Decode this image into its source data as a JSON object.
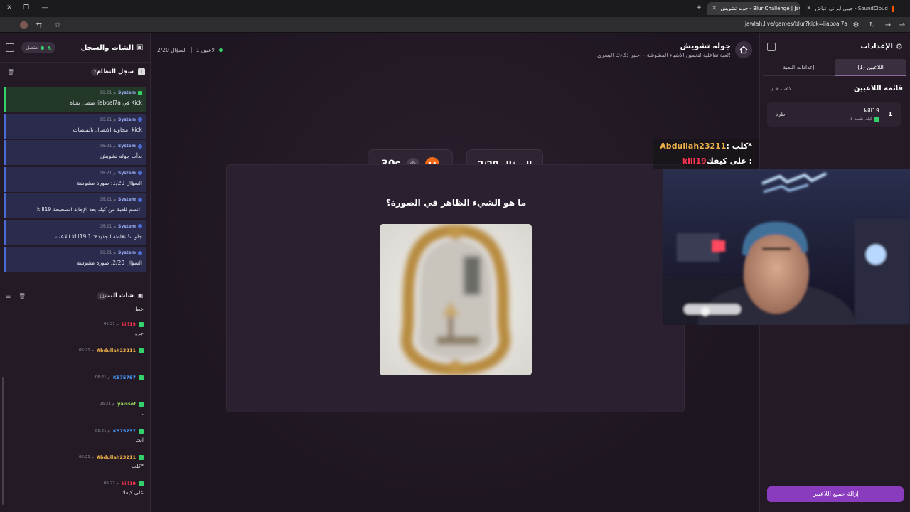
{
  "browser": {
    "tabs": [
      {
        "label": "جيبي ابراني عياش - SoundCloud",
        "favicon_color": "#ff5500"
      },
      {
        "label": "جوله تشويش - Blur Challenge | Jawla",
        "favicon_color": "#cccccc"
      }
    ],
    "url": "jawlah.live/games/blur?kick=iiaboal7a"
  },
  "left_panel": {
    "title": "الشات والسجل",
    "status": "متصل",
    "system_log": {
      "title": "سجل النظام",
      "count": "7",
      "messages": [
        {
          "sender": "System",
          "time": "06:21 م",
          "text": "متصل بقناة iiaboal7a في Kick"
        },
        {
          "sender": "System",
          "time": "06:21 م",
          "text": "محاولة الاتصال بالمنصات: kick"
        },
        {
          "sender": "System",
          "time": "06:21 م",
          "text": "بدأت جوله تشويش"
        },
        {
          "sender": "System",
          "time": "06:21 م",
          "text": "السؤال 1/20: صورة مشوشة"
        },
        {
          "sender": "System",
          "time": "06:21 م",
          "text": "kill19 انضم للعبة من كيك بعد الإجابة الصحيحة!"
        },
        {
          "sender": "System",
          "time": "06:21 م",
          "text": "اللاعب kill19 جاوب! نقاطه الجديدة: 1"
        },
        {
          "sender": "System",
          "time": "06:21 م",
          "text": "السؤال 2/20: صورة مشوشة"
        }
      ]
    },
    "live_chat": {
      "title": "شات البث",
      "count": "11",
      "first_text": "خط",
      "messages": [
        {
          "user": "kill19",
          "time": "06:21 م",
          "text": "جرو",
          "color": "#ff3550"
        },
        {
          "user": "Abdullah23211",
          "time": "06:21 م",
          "text": "..",
          "color": "#f0b34a"
        },
        {
          "user": "K575757",
          "time": "06:21 م",
          "text": "..",
          "color": "#4a9cff"
        },
        {
          "user": "yaissef",
          "time": "06:21 م",
          "text": "..",
          "color": "#9be05a"
        },
        {
          "user": "K575757",
          "time": "06:21 م",
          "text": "انت",
          "color": "#4a9cff"
        },
        {
          "user": "Abdullah23211",
          "time": "06:21 م",
          "text": "كلب*",
          "color": "#f0b34a"
        },
        {
          "user": "kill19",
          "time": "06:21 م",
          "text": "على كيفك",
          "color": "#ff3550"
        }
      ]
    }
  },
  "main": {
    "game_title": "جوله تشويش",
    "game_subtitle": "لعبة تفاعلية لتخمين الأشياء المشوشة - اختبر ذكاءك البصري!",
    "players_meta": "1 لاعبين",
    "question_meta": "السؤال 2/20",
    "timer": "30s",
    "question_counter": "السؤال 2/20",
    "question": "ما هو الشيء الظاهر في الصورة؟"
  },
  "right_panel": {
    "title": "الإعدادات",
    "tabs": [
      "اللاعبين (1)",
      "إعدادات اللعبة"
    ],
    "active_tab": 0,
    "players_heading": "قائمة اللاعبين",
    "players_count": "1 / ∞ لاعب",
    "players": [
      {
        "rank": "1",
        "name": "kill19",
        "sub": "1 نقطة",
        "platform": "كيك",
        "kick_label": "طرد"
      }
    ],
    "clear_button": "إزالة جميع اللاعبين"
  },
  "overlay": {
    "line1_name": "Abdullah23211",
    "line1_text": ": كلب*",
    "line2_name": "kill19",
    "line2_text": "على كيفك : "
  },
  "colors": {
    "accent_purple": "#8a3cbf",
    "kick_green": "#35d26b",
    "pause_orange": "#f06a18"
  }
}
